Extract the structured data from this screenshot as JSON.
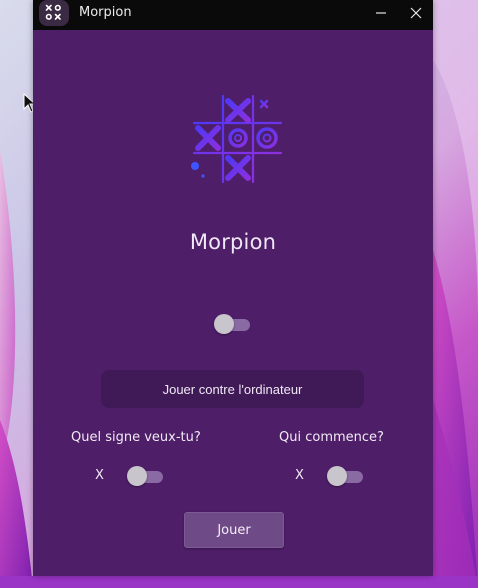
{
  "window": {
    "title": "Morpion"
  },
  "icons": {
    "app": "tic-tac-toe-icon",
    "minimize": "minimize-icon",
    "close": "close-icon",
    "logo": "tic-tac-toe-logo",
    "cursor": "mouse-pointer-icon"
  },
  "main": {
    "app_title": "Morpion",
    "vs_computer_label": "Jouer contre l'ordinateur",
    "sign_question": "Quel signe veux-tu?",
    "sign_value": "X",
    "first_question": "Qui commence?",
    "first_value": "X",
    "play_label": "Jouer"
  },
  "switches": {
    "top_on": false,
    "sign_on": false,
    "first_on": false
  },
  "colors": {
    "window_bg": "#4e1e68",
    "titlebar": "#0a0a0a",
    "logo_gradient_start": "#5b2ee8",
    "logo_gradient_end": "#8e2de2",
    "button_dark": "#401a57",
    "button_play": "#6e4a86"
  }
}
